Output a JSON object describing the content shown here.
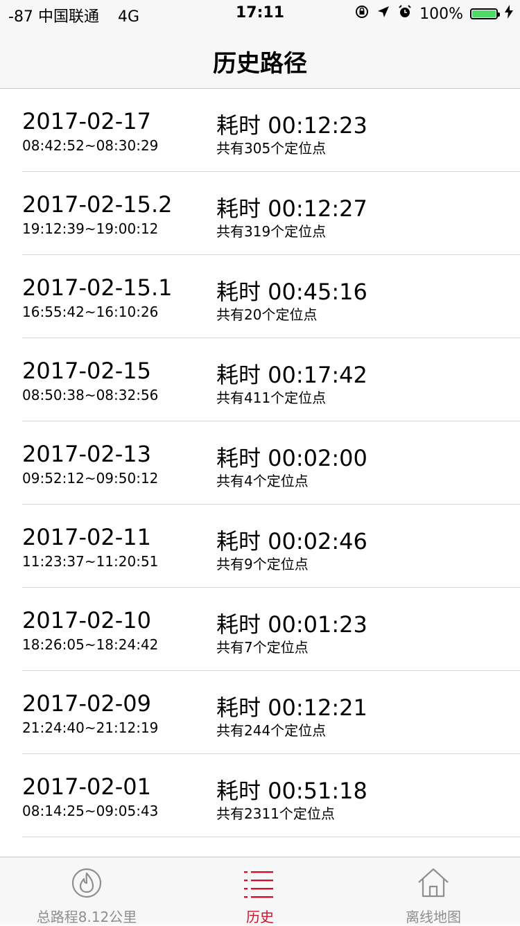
{
  "status_bar": {
    "signal": "-87",
    "carrier": "中国联通",
    "network": "4G",
    "time": "17:11",
    "battery_text": "100%",
    "battery_level": 1.0
  },
  "nav": {
    "title": "历史路径"
  },
  "records": [
    {
      "date": "2017-02-17",
      "range": "08:42:52~08:30:29",
      "duration": "耗时 00:12:23",
      "points": "共有305个定位点"
    },
    {
      "date": "2017-02-15.2",
      "range": "19:12:39~19:00:12",
      "duration": "耗时 00:12:27",
      "points": "共有319个定位点"
    },
    {
      "date": "2017-02-15.1",
      "range": "16:55:42~16:10:26",
      "duration": "耗时 00:45:16",
      "points": "共有20个定位点"
    },
    {
      "date": "2017-02-15",
      "range": "08:50:38~08:32:56",
      "duration": "耗时 00:17:42",
      "points": "共有411个定位点"
    },
    {
      "date": "2017-02-13",
      "range": "09:52:12~09:50:12",
      "duration": "耗时 00:02:00",
      "points": "共有4个定位点"
    },
    {
      "date": "2017-02-11",
      "range": "11:23:37~11:20:51",
      "duration": "耗时 00:02:46",
      "points": "共有9个定位点"
    },
    {
      "date": "2017-02-10",
      "range": "18:26:05~18:24:42",
      "duration": "耗时 00:01:23",
      "points": "共有7个定位点"
    },
    {
      "date": "2017-02-09",
      "range": "21:24:40~21:12:19",
      "duration": "耗时 00:12:21",
      "points": "共有244个定位点"
    },
    {
      "date": "2017-02-01",
      "range": "08:14:25~09:05:43",
      "duration": "耗时 00:51:18",
      "points": "共有2311个定位点"
    }
  ],
  "tabs": [
    {
      "label": "总路程8.12公里",
      "icon": "flame-icon",
      "active": false
    },
    {
      "label": "历史",
      "icon": "list-icon",
      "active": true
    },
    {
      "label": "离线地图",
      "icon": "home-icon",
      "active": false
    }
  ],
  "colors": {
    "accent": "#d0112b",
    "inactive": "#8e8e8e",
    "battery": "#4cd964"
  }
}
